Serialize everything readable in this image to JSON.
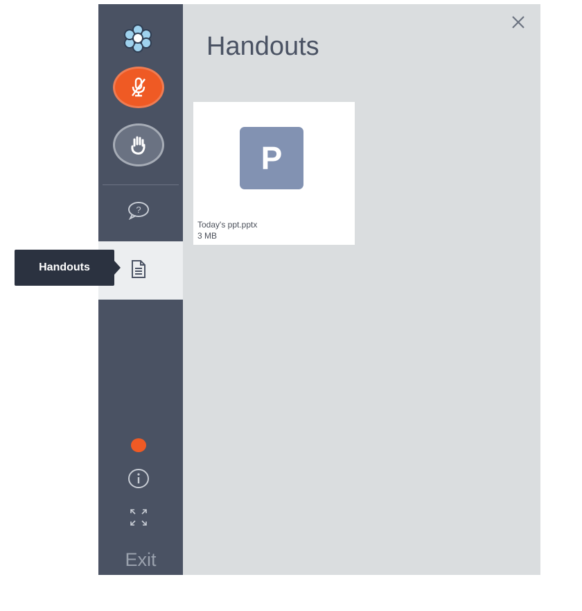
{
  "sidebar": {
    "logo_icon": "flower-logo-icon",
    "mic_icon": "mic-muted-icon",
    "hand_icon": "raise-hand-icon",
    "qa_icon": "question-chat-icon",
    "handouts_icon": "document-icon",
    "info_icon": "info-icon",
    "expand_icon": "expand-icon",
    "exit_label": "Exit"
  },
  "tooltip": {
    "label": "Handouts"
  },
  "panel": {
    "title": "Handouts",
    "close_icon": "close-icon",
    "files": [
      {
        "name": "Today's ppt.pptx",
        "size": "3 MB",
        "icon_letter": "P"
      }
    ]
  },
  "colors": {
    "sidebar_bg": "#4a5263",
    "accent_orange": "#ef5a24",
    "panel_bg": "#dadddf",
    "file_thumb": "#8292b2"
  }
}
